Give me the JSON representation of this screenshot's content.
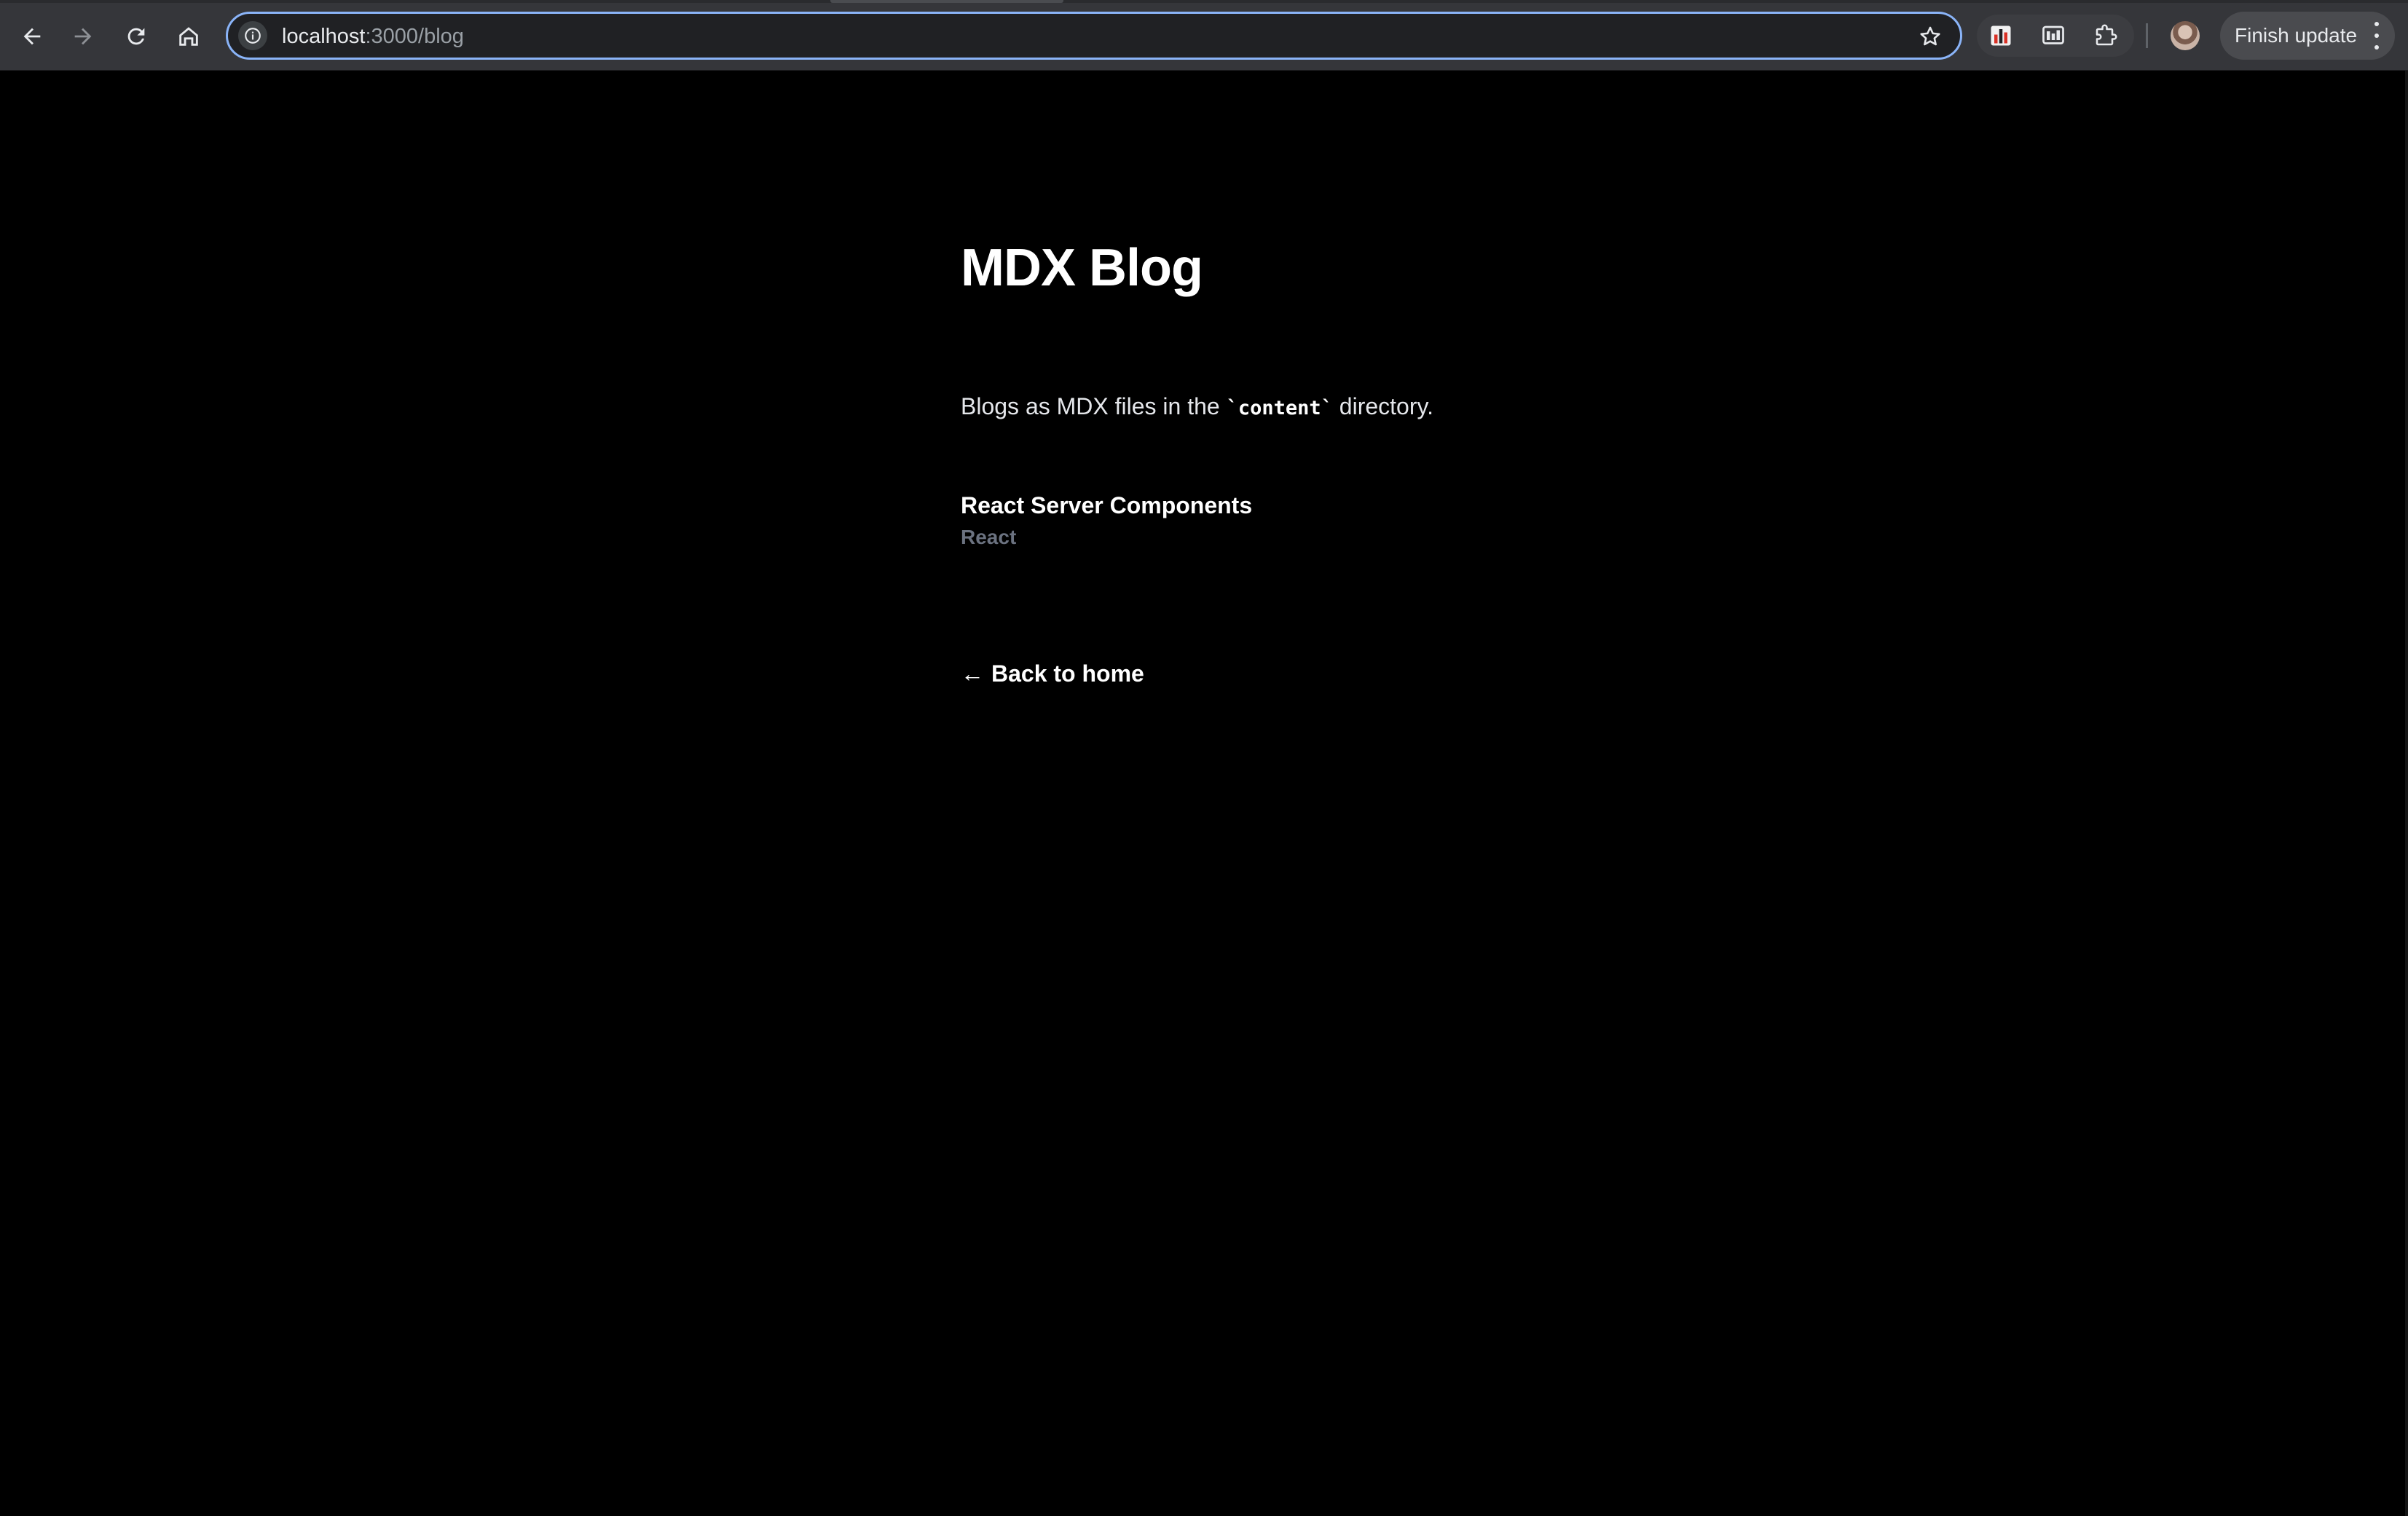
{
  "browser": {
    "url_host": "localhost",
    "url_path": ":3000/blog",
    "update_label": "Finish update",
    "icons": {
      "back": "arrow-left-icon",
      "forward": "arrow-right-icon",
      "reload": "reload-icon",
      "home": "home-icon",
      "site_info": "info-icon",
      "bookmark": "star-icon",
      "extensions": "puzzle-icon",
      "menu": "kebab-menu-icon"
    }
  },
  "page": {
    "title": "MDX Blog",
    "intro_before": "Blogs as MDX files in the ",
    "intro_code": "`content`",
    "intro_after": " directory.",
    "posts": [
      {
        "title": "React Server Components",
        "tag": "React"
      }
    ],
    "back_arrow": "←",
    "back_label": "Back to home"
  },
  "colors": {
    "background": "#000000",
    "toolbar": "#35363a",
    "omnibox_focus": "#8ab4f8",
    "muted_text": "#6b7280"
  }
}
